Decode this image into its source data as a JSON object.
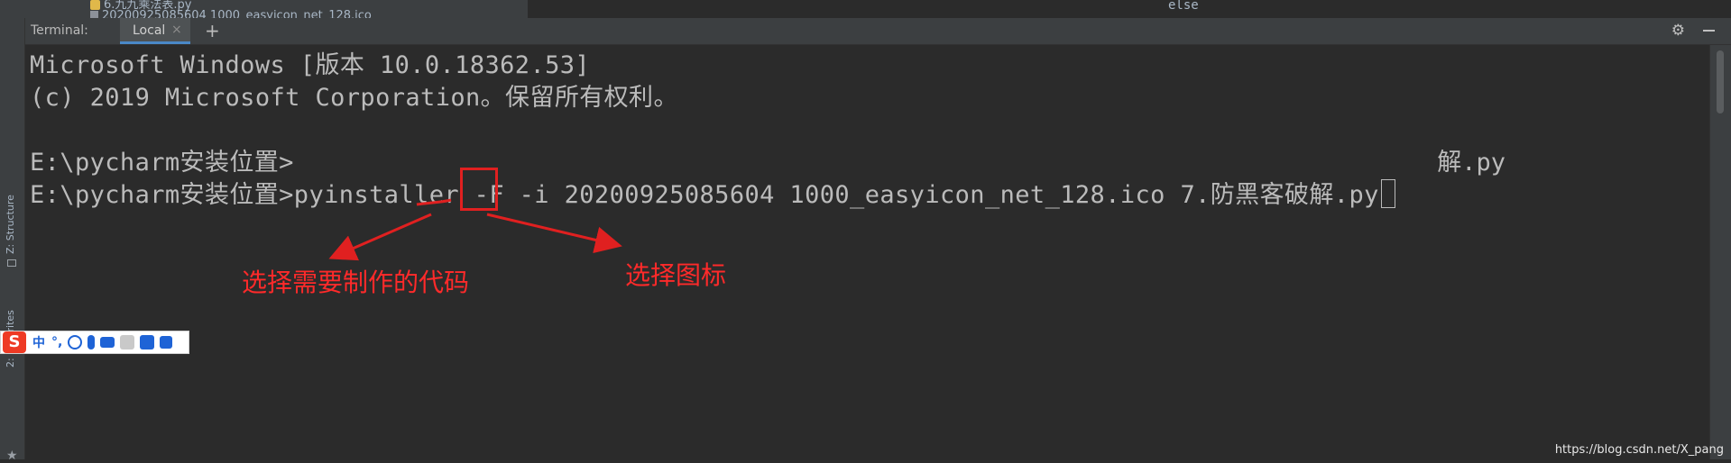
{
  "top": {
    "tree_file_1": "6.九九乘法表.py",
    "tree_file_2": "20200925085604 1000_easyicon_net_128.ico",
    "editor_text": "else"
  },
  "left_stripe": {
    "structure_label": "Z: Structure",
    "favorites_label": "2: Favorites"
  },
  "terminal": {
    "title": "Terminal:",
    "tab_label": "Local",
    "tab_close": "×",
    "add_tab": "+",
    "lines": {
      "l1": "Microsoft Windows [版本 10.0.18362.53]",
      "l2": "(c) 2019 Microsoft Corporation。保留所有权利。",
      "l3_prompt": "E:\\pycharm安装位置>",
      "l3_tail": "解.py",
      "l4": "E:\\pycharm安装位置>pyinstaller -F -i 20200925085604 1000_easyicon_net_128.ico 7.防黑客破解.py"
    }
  },
  "annotations": {
    "label_code": "选择需要制作的代码",
    "label_icon": "选择图标"
  },
  "ime": {
    "logo": "S",
    "mode": "中",
    "punct": "°,"
  },
  "watermark": "https://blog.csdn.net/X_pang",
  "colors": {
    "terminal_bg": "#2b2b2b",
    "terminal_fg": "#bbbbbb",
    "annotation_red": "#e02020",
    "tab_underline": "#4a88c7"
  },
  "icons": {
    "gear": "gear-icon",
    "minimize": "minimize-icon"
  }
}
